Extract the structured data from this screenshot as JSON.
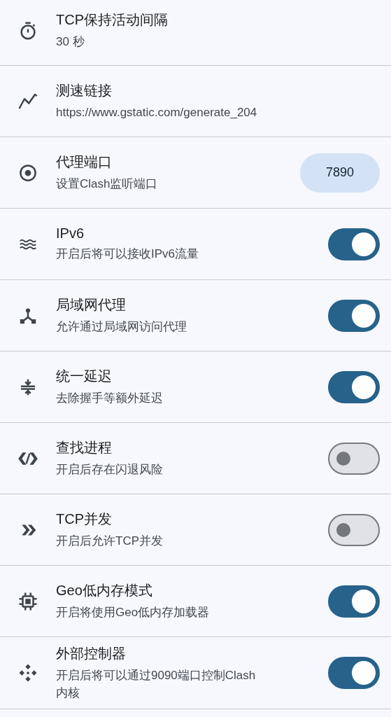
{
  "settings": [
    {
      "title": "TCP保持活动间隔",
      "subtitle": "30 秒",
      "kind": "plain"
    },
    {
      "title": "测速链接",
      "subtitle": "https://www.gstatic.com/generate_204",
      "kind": "plain"
    },
    {
      "title": "代理端口",
      "subtitle": "设置Clash监听端口",
      "kind": "chip",
      "value": "7890"
    },
    {
      "title": "IPv6",
      "subtitle": "开启后将可以接收IPv6流量",
      "kind": "switch",
      "on": true
    },
    {
      "title": "局域网代理",
      "subtitle": "允许通过局域网访问代理",
      "kind": "switch",
      "on": true
    },
    {
      "title": "统一延迟",
      "subtitle": "去除握手等额外延迟",
      "kind": "switch",
      "on": true
    },
    {
      "title": "查找进程",
      "subtitle": "开启后存在闪退风险",
      "kind": "switch",
      "on": false
    },
    {
      "title": "TCP并发",
      "subtitle": "开启后允许TCP并发",
      "kind": "switch",
      "on": false
    },
    {
      "title": "Geo低内存模式",
      "subtitle": "开启将使用Geo低内存加载器",
      "kind": "switch",
      "on": true
    },
    {
      "title": "外部控制器",
      "subtitle": "开启后将可以通过9090端口控制Clash内核",
      "kind": "switch",
      "on": true
    }
  ]
}
